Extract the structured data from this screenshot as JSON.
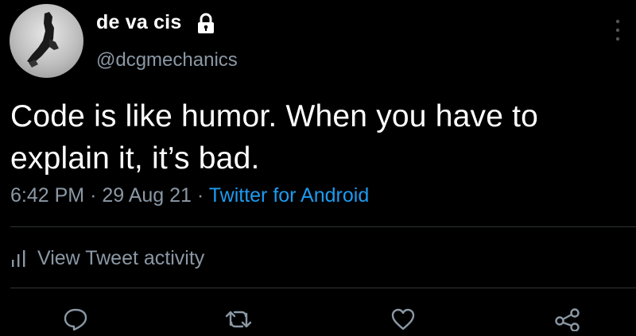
{
  "author": {
    "display_name": "de va cis",
    "handle": "@dcgmechanics",
    "icons": [
      "lock-icon",
      "more-icon"
    ]
  },
  "tweet": {
    "text": "Code is like humor. When you have to explain it, it’s bad.",
    "time": "6:42 PM",
    "separator": "·",
    "date": "29 Aug 21",
    "source": "Twitter for Android"
  },
  "activity": {
    "label": "View Tweet activity",
    "icon": "bar-chart-icon"
  },
  "actions": {
    "icons": [
      "reply-icon",
      "retweet-icon",
      "like-icon",
      "share-icon"
    ]
  },
  "colors": {
    "background": "#000000",
    "primary_text": "#ffffff",
    "secondary_text": "#8b98a5",
    "link": "#1d9bf0",
    "divider": "#2f3336"
  }
}
